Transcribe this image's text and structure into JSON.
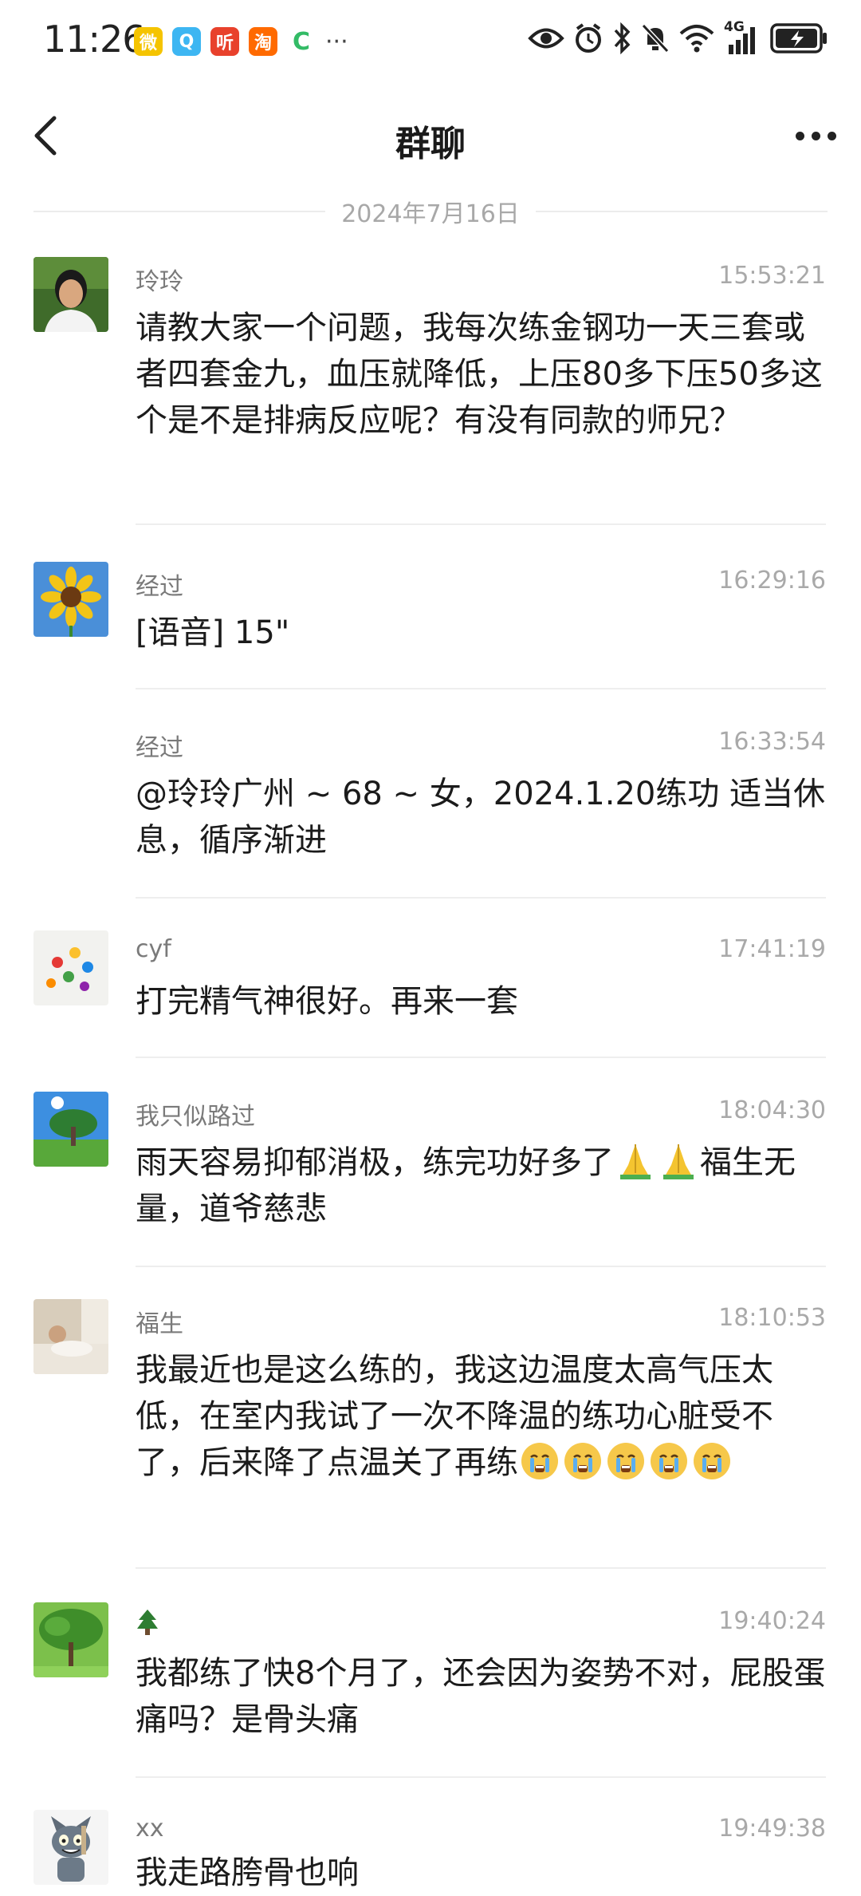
{
  "status_bar": {
    "time": "11:26",
    "apps": [
      {
        "name": "weibo-icon",
        "color": "#f5c400",
        "glyph": "微"
      },
      {
        "name": "qq-icon",
        "color": "#3db6f2",
        "glyph": "Q"
      },
      {
        "name": "ting-icon",
        "color": "#e8412c",
        "glyph": "听"
      },
      {
        "name": "taobao-icon",
        "color": "#ff6a00",
        "glyph": "淘"
      },
      {
        "name": "refresh-icon",
        "color": "#33bb66",
        "glyph": "C"
      }
    ],
    "more": "···",
    "network": "4G"
  },
  "header": {
    "title": "群聊"
  },
  "date_divider": "2024年7月16日",
  "messages": [
    {
      "sender": "玲玲",
      "time": "15:53:21",
      "text": "请教大家一个问题，我每次练金钢功一天三套或者四套金九，血压就降低，上压80多下压50多这个是不是排病反应呢？有没有同款的师兄？",
      "avatar": "portrait"
    },
    {
      "sender": "经过",
      "time": "16:29:16",
      "text": "[语音] 15\"",
      "avatar": "sunflower"
    },
    {
      "sender": "经过",
      "time": "16:33:54",
      "text": "@玲玲广州 ~ 68 ~ 女，2024.1.20练功 适当休息，循序渐进",
      "avatar": ""
    },
    {
      "sender": "cyf",
      "time": "17:41:19",
      "text": "打完精气神很好。再来一套",
      "avatar": "marbles"
    },
    {
      "sender": "我只似路过",
      "time": "18:04:30",
      "text": "雨天容易抑郁消极，练完功好多了",
      "text_after": "福生无量，道爷慈悲",
      "avatar": "tree-sky"
    },
    {
      "sender": "福生",
      "time": "18:10:53",
      "text": "我最近也是这么练的，我这边温度太高气压太低，在室内我试了一次不降温的练功心脏受不了，后来降了点温关了再练",
      "avatar": "bedroom"
    },
    {
      "sender": "🌲",
      "time": "19:40:24",
      "text": "我都练了快8个月了，还会因为姿势不对，屁股蛋痛吗？是骨头痛",
      "avatar": "green-tree"
    },
    {
      "sender": "xx",
      "time": "19:49:38",
      "text": "我走路胯骨也响",
      "avatar": "cartoon-cat"
    }
  ]
}
